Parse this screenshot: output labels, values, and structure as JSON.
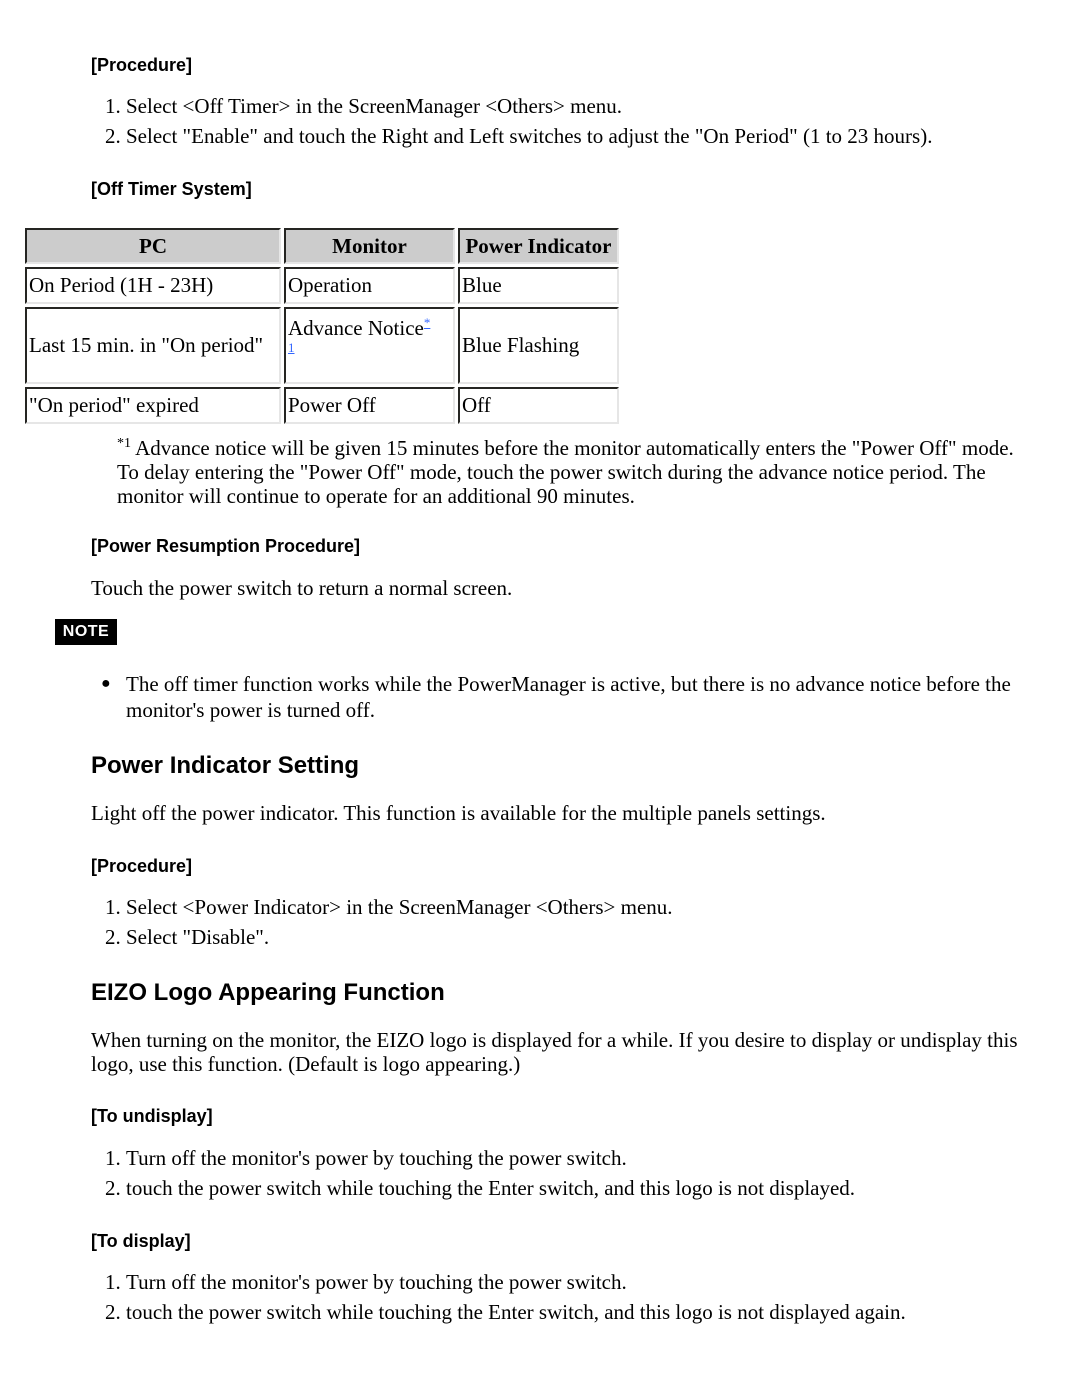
{
  "section1": {
    "procedure_heading": "[Procedure]",
    "steps": [
      "Select <Off Timer> in the ScreenManager <Others> menu.",
      "Select \"Enable\" and touch the Right and Left switches to adjust the \"On Period\" (1 to 23 hours)."
    ],
    "system_heading": "[Off Timer System]",
    "table": {
      "headers": [
        "PC",
        "Monitor",
        "Power Indicator"
      ],
      "rows": [
        [
          "On Period (1H - 23H)",
          "Operation",
          "Blue"
        ],
        [
          "Last 15 min. in \"On period\"",
          "Advance Notice",
          "Blue Flashing"
        ],
        [
          "\"On period\" expired",
          "Power Off",
          "Off"
        ]
      ],
      "footnote_ref_a": "*",
      "footnote_ref_b": "1"
    },
    "footnote_marker": "*1",
    "footnote_text": " Advance notice will be given 15 minutes before the monitor automatically enters the \"Power Off\" mode. To delay entering the \"Power Off\" mode, touch the power switch during the advance notice period. The monitor will continue to operate for an additional 90 minutes.",
    "resumption_heading": "[Power Resumption Procedure]",
    "resumption_text": "Touch the power switch to return a normal screen.",
    "note_badge": "NOTE",
    "notes": [
      "The off timer function works while the PowerManager is active, but there is no advance notice before the monitor's power is turned off."
    ]
  },
  "section2": {
    "title": "Power Indicator Setting",
    "description": "Light off the power indicator. This function is available for the multiple panels settings.",
    "procedure_heading": "[Procedure]",
    "steps": [
      "Select <Power Indicator> in the ScreenManager <Others> menu.",
      "Select \"Disable\"."
    ]
  },
  "section3": {
    "title": "EIZO Logo Appearing Function",
    "description": "When turning on the monitor, the EIZO logo is displayed for a while. If you desire to display or undisplay this logo, use this function. (Default is logo appearing.)",
    "undisplay_heading": "[To undisplay]",
    "undisplay_steps": [
      "Turn off the monitor's power by touching the power switch.",
      "touch the power switch while touching the Enter switch, and this logo is not displayed."
    ],
    "display_heading": "[To display]",
    "display_steps": [
      "Turn off the monitor's power by touching the power switch.",
      "touch the power switch while touching the Enter switch, and this logo is not displayed again."
    ]
  },
  "colors": {
    "link": "#3366ff",
    "table_header_bg": "#cccccc",
    "note_badge_bg": "#000000"
  }
}
